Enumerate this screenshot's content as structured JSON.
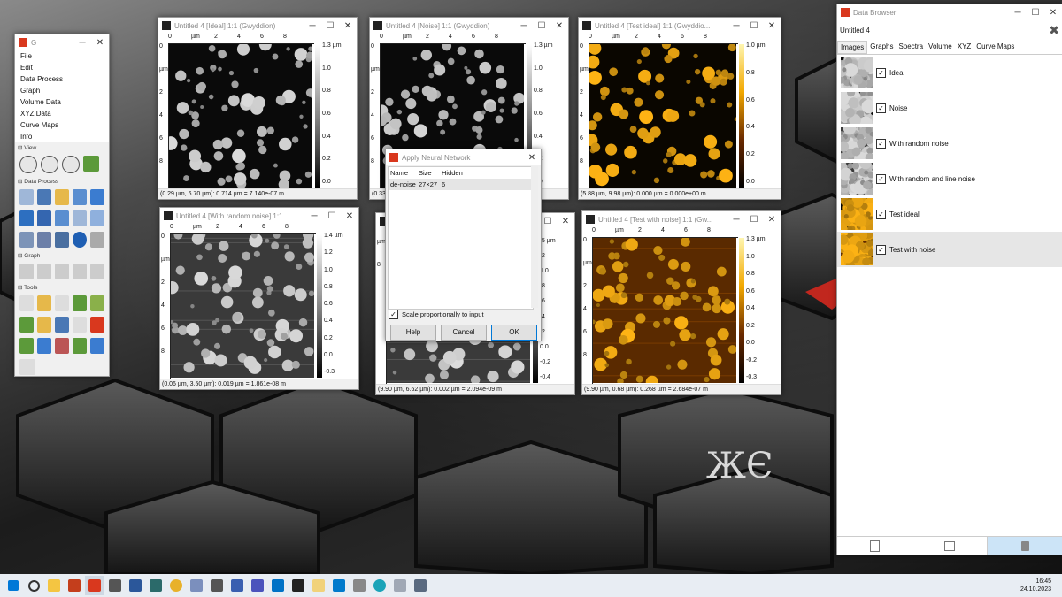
{
  "desktop": {
    "logo": "ЖЄ"
  },
  "gwy_main": {
    "title": "G",
    "menu": [
      "File",
      "Edit",
      "Data Process",
      "Graph",
      "Volume Data",
      "XYZ Data",
      "Curve Maps",
      "Info"
    ],
    "sections": [
      "View",
      "Data Process",
      "Graph",
      "Tools"
    ]
  },
  "image_windows": [
    {
      "title": "Untitled 4 [Ideal] 1:1 (Gwyddion)",
      "status": "(0.29 µm, 6.70 µm): 0.714 µm = 7.140e-07 m",
      "ticks_h": [
        "0",
        "µm",
        "2",
        "4",
        "6",
        "8"
      ],
      "ticks_v": [
        "0",
        "µm",
        "2",
        "4",
        "6",
        "8"
      ],
      "scale": [
        "1.3 µm",
        "1.0",
        "0.8",
        "0.6",
        "0.4",
        "0.2",
        "0.0"
      ],
      "palette": "gray"
    },
    {
      "title": "Untitled 4 [Noise] 1:1 (Gwyddion)",
      "status": "(0.33",
      "ticks_h": [
        "0",
        "µm",
        "2",
        "4",
        "6",
        "8"
      ],
      "ticks_v": [
        "0",
        "µm",
        "2",
        "4",
        "6",
        "8"
      ],
      "scale": [
        "1.3 µm",
        "1.0",
        "0.8",
        "0.6",
        "0.4",
        "0.2",
        "0.0"
      ],
      "palette": "gray"
    },
    {
      "title": "Untitled 4 [Test ideal] 1:1 (Gwyddio...",
      "status": "(5.88 µm, 9.98 µm): 0.000 µm = 0.000e+00 m",
      "ticks_h": [
        "0",
        "µm",
        "2",
        "4",
        "6",
        "8"
      ],
      "ticks_v": [
        "0",
        "µm",
        "2",
        "4",
        "6",
        "8"
      ],
      "scale": [
        "1.0 µm",
        "0.8",
        "0.6",
        "0.4",
        "0.2",
        "0.0"
      ],
      "palette": "gold"
    },
    {
      "title": "Untitled 4 [With random noise] 1:1...",
      "status": "(0.06 µm, 3.50 µm): 0.019 µm = 1.861e-08 m",
      "ticks_h": [
        "0",
        "µm",
        "2",
        "4",
        "6",
        "8"
      ],
      "ticks_v": [
        "0",
        "µm",
        "2",
        "4",
        "6",
        "8"
      ],
      "scale": [
        "1.4 µm",
        "1.2",
        "1.0",
        "0.8",
        "0.6",
        "0.4",
        "0.2",
        "0.0",
        "-0.3"
      ],
      "palette": "gray"
    },
    {
      "title": "",
      "status": "(9.90 µm, 6.62 µm): 0.002 µm = 2.094e-09 m",
      "ticks_h": [],
      "ticks_v": [
        "µm",
        "8"
      ],
      "scale": [
        ".5 µm",
        ".2",
        "1.0",
        ".8",
        ".6",
        ".4",
        ".2",
        "0.0",
        "-0.2",
        "-0.4"
      ],
      "palette": "gray"
    },
    {
      "title": "Untitled 4 [Test with noise] 1:1 (Gw...",
      "status": "(9.90 µm, 0.68 µm): 0.268 µm = 2.684e-07 m",
      "ticks_h": [
        "0",
        "µm",
        "2",
        "4",
        "6",
        "8"
      ],
      "ticks_v": [
        "0",
        "µm",
        "2",
        "4",
        "6",
        "8"
      ],
      "scale": [
        "1.3 µm",
        "1.0",
        "0.8",
        "0.6",
        "0.4",
        "0.2",
        "0.0",
        "-0.2",
        "-0.3"
      ],
      "palette": "gold"
    }
  ],
  "dialog": {
    "title": "Apply Neural Network",
    "columns": [
      "Name",
      "Size",
      "Hidden"
    ],
    "row": {
      "name": "de-noise",
      "size": "27×27",
      "hidden": "6"
    },
    "checkbox": "Scale proportionally to input",
    "help": "Help",
    "cancel": "Cancel",
    "ok": "OK"
  },
  "data_browser": {
    "title": "Data Browser",
    "file": "Untitled 4",
    "tabs": [
      "Images",
      "Graphs",
      "Spectra",
      "Volume",
      "XYZ",
      "Curve Maps"
    ],
    "items": [
      "Ideal",
      "Noise",
      "With random noise",
      "With random and line noise",
      "Test ideal",
      "Test with noise"
    ]
  },
  "taskbar": {
    "time": "16:45",
    "date": "24.10.2023"
  },
  "colors": {
    "gwy_red": "#d9381e",
    "gold": "#f2a800",
    "accent": "#0078d7"
  }
}
